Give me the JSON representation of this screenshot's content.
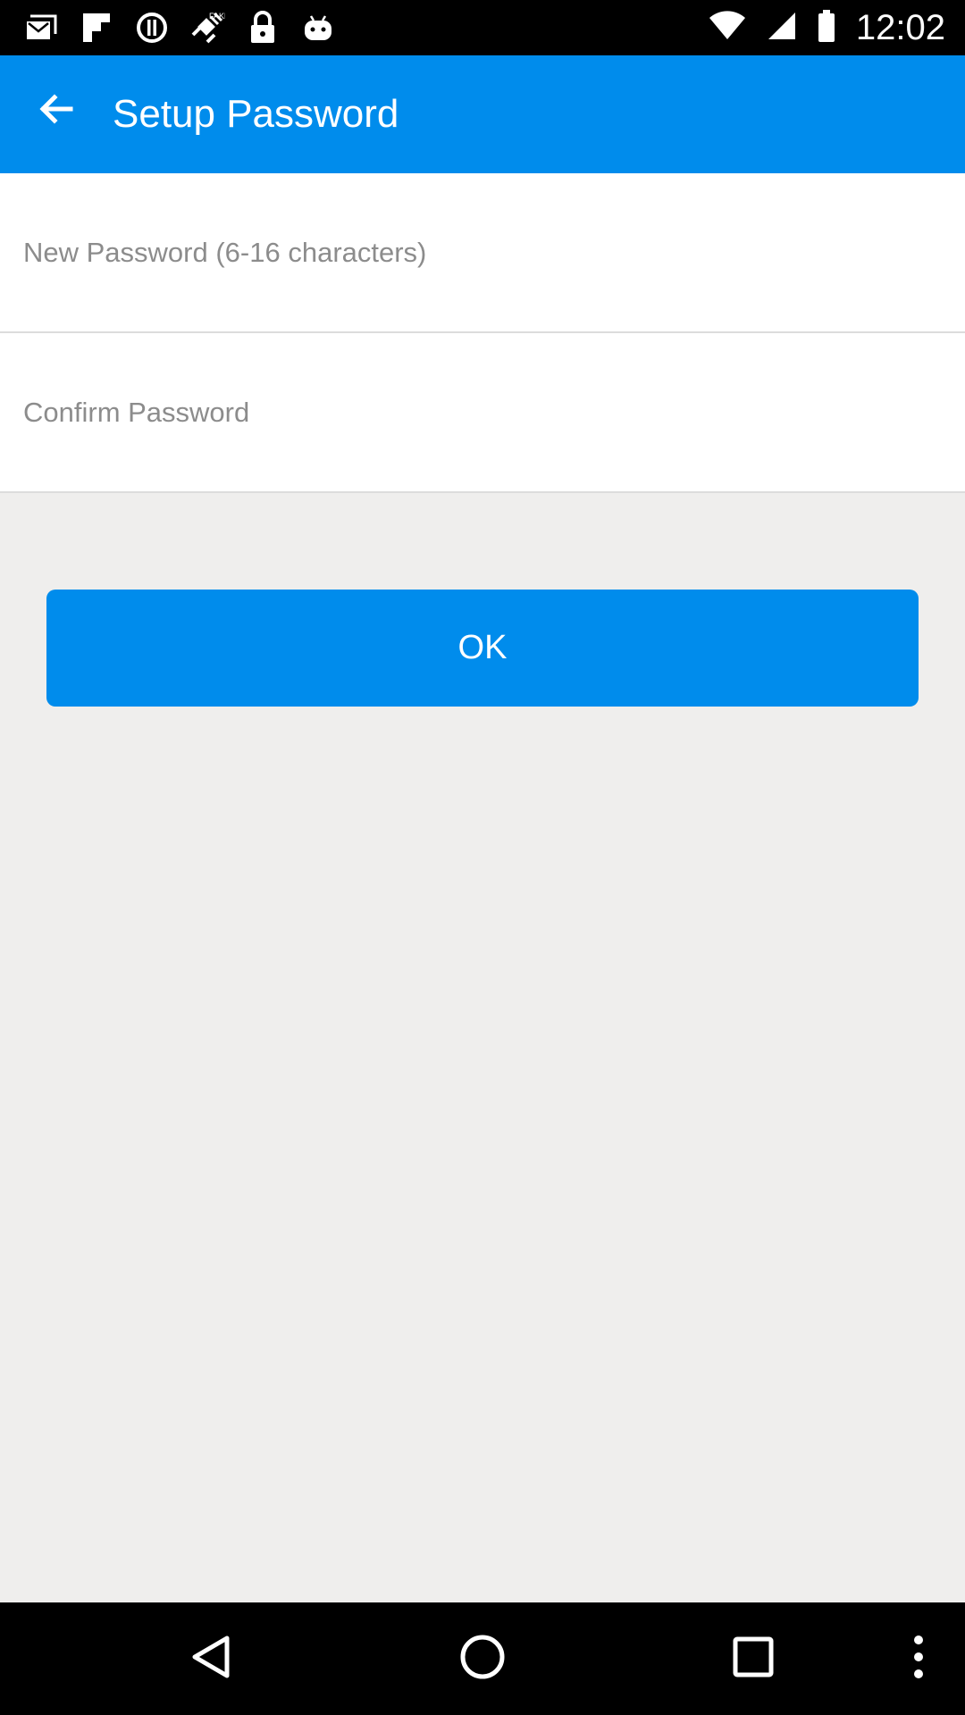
{
  "status_bar": {
    "time": "12:02",
    "icons": [
      "mail-icon",
      "flipboard-icon",
      "alert-icon",
      "fake-gps-icon",
      "lock-icon",
      "android-icon",
      "wifi-icon",
      "signal-icon",
      "battery-icon"
    ]
  },
  "app_bar": {
    "title": "Setup Password",
    "back_icon": "arrow-back-icon"
  },
  "form": {
    "new_password": {
      "placeholder": "New Password (6-16 characters)",
      "value": ""
    },
    "confirm_password": {
      "placeholder": "Confirm Password",
      "value": ""
    }
  },
  "ok_button": {
    "label": "OK"
  },
  "nav_bar": {
    "icons": [
      "back-triangle-icon",
      "home-circle-icon",
      "recents-square-icon",
      "overflow-menu-icon"
    ]
  },
  "colors": {
    "primary": "#008cec",
    "background": "#efeeed",
    "surface": "#ffffff",
    "placeholder": "#8c8c8c"
  }
}
